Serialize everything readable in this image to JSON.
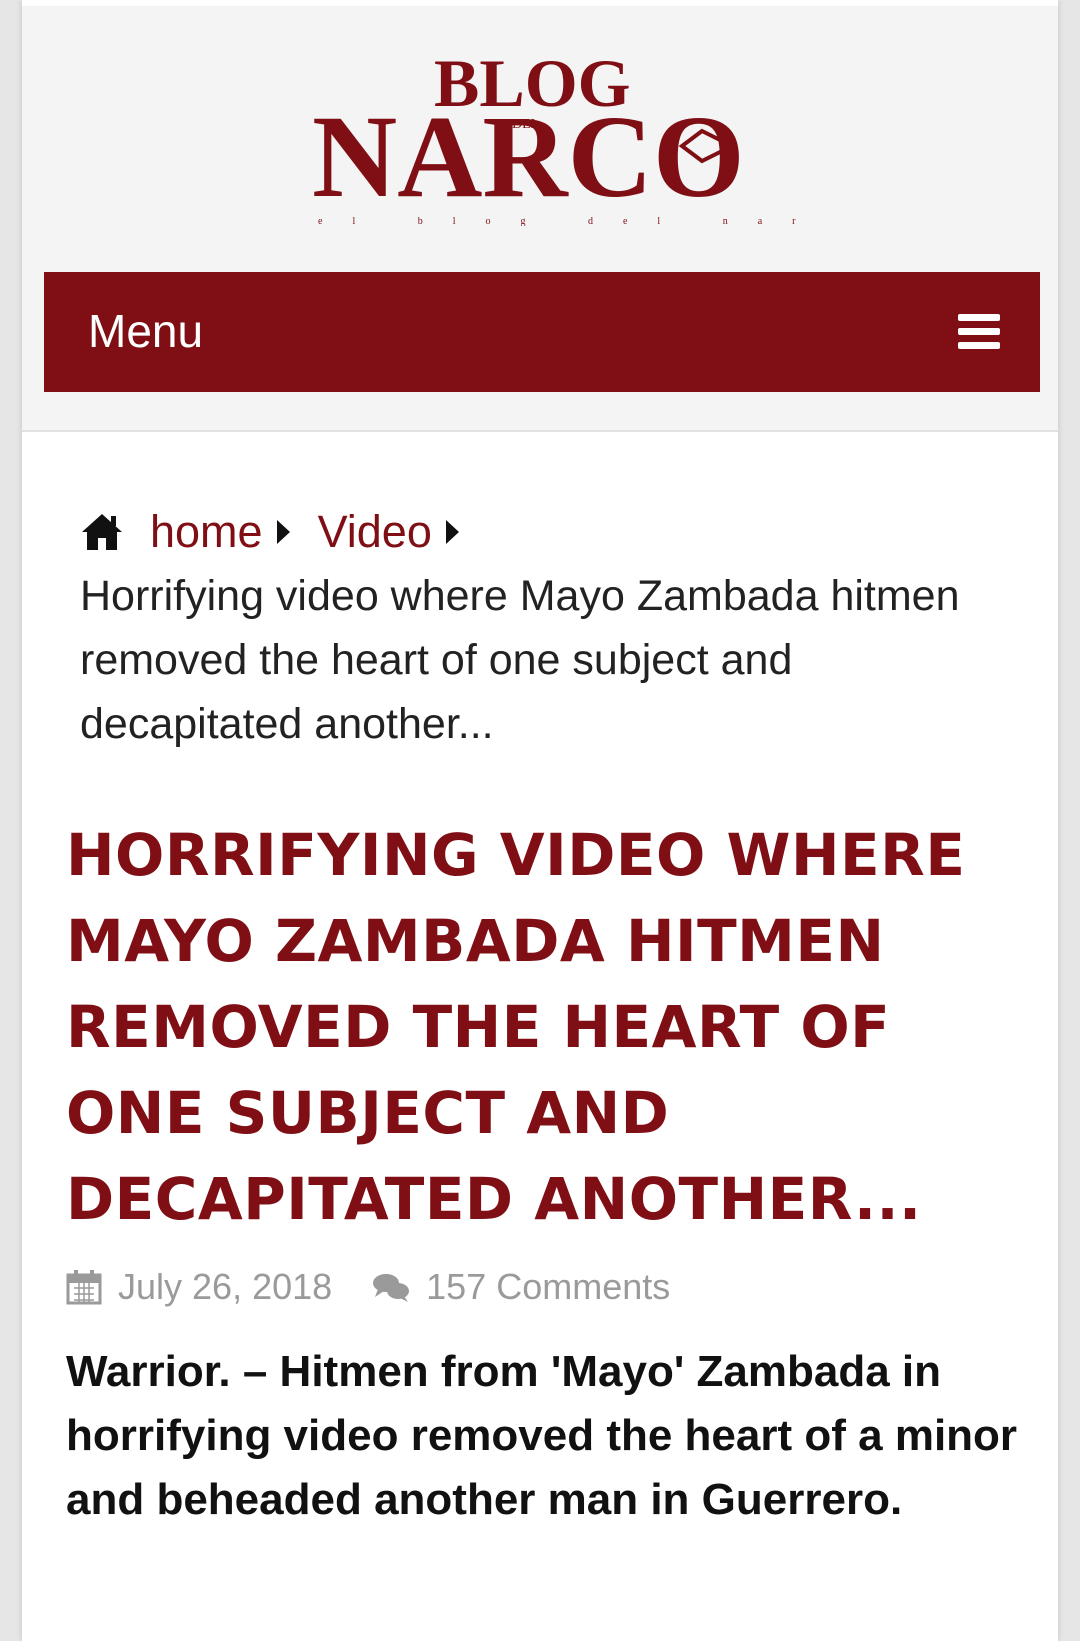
{
  "header": {
    "logo_text_top": "BLOG",
    "logo_text_small": "DEL",
    "logo_text_main": "NARCO",
    "logo_tagline": "el blog del narco",
    "menu_label": "Menu"
  },
  "breadcrumb": {
    "home_label": "home",
    "category_label": "Video",
    "current_label": "Horrifying video where Mayo Zambada hitmen removed the heart of one subject and decapitated another..."
  },
  "post": {
    "title": "HORRIFYING VIDEO WHERE MAYO ZAMBADA HITMEN REMOVED THE HEART OF ONE SUBJECT AND DECAPITATED ANOTHER...",
    "date": "July 26, 2018",
    "comments": "157 Comments",
    "lead": "Warrior. – Hitmen from 'Mayo' Zambada in horrifying video removed the heart of a minor and beheaded another man in Guerrero."
  },
  "colors": {
    "brand": "#7f0f14",
    "meta_gray": "#9a9a9a"
  },
  "icons": {
    "home": "home-icon",
    "calendar": "calendar-icon",
    "comments": "comments-icon",
    "menu": "hamburger-icon"
  }
}
